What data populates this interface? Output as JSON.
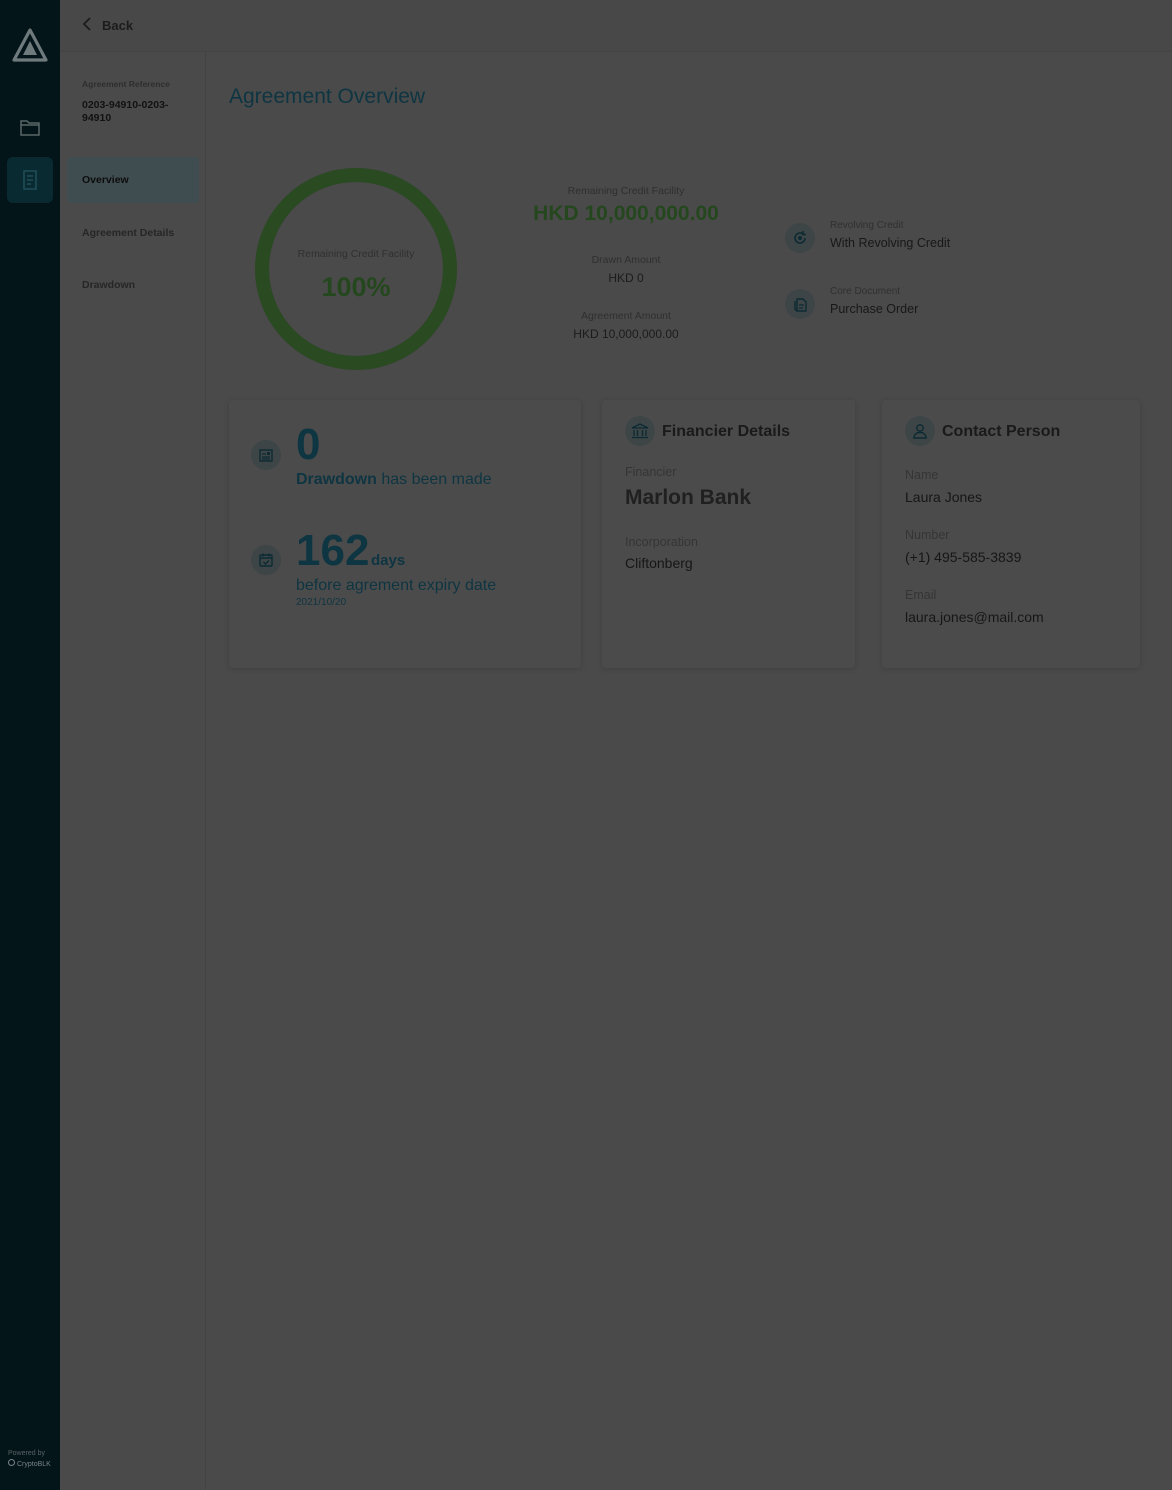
{
  "rail": {
    "icons": [
      "logo-icon",
      "folder-icon",
      "document-icon"
    ],
    "powered_by": "Powered by",
    "brand": "CryptoBLK"
  },
  "topbar": {
    "back_label": "Back"
  },
  "subnav": {
    "reference_label": "Agreement Reference",
    "reference_value": "0203-94910-0203-94910",
    "items": [
      {
        "label": "Overview",
        "active": true
      },
      {
        "label": "Agreement Details",
        "active": false
      },
      {
        "label": "Drawdown",
        "active": false
      }
    ]
  },
  "main": {
    "title": "Agreement Overview",
    "donut": {
      "label": "Remaining Credit Facility",
      "percent_text": "100%",
      "remaining_fraction": 1.0,
      "color": "#2a4a22"
    },
    "summary": {
      "remaining_label": "Remaining Credit Facility",
      "remaining_value": "HKD 10,000,000.00",
      "drawn_label": "Drawn Amount",
      "drawn_value": "HKD 0",
      "agreement_label": "Agreement Amount",
      "agreement_value": "HKD 10,000,000.00"
    },
    "attributes": [
      {
        "icon": "revolving-icon",
        "label": "Revolving Credit",
        "value": "With Revolving Credit"
      },
      {
        "icon": "documents-icon",
        "label": "Core Document",
        "value": "Purchase Order"
      }
    ],
    "stats": {
      "drawdown_count": "0",
      "drawdown_word": "Drawdown",
      "drawdown_rest": "has been made",
      "days_count": "162",
      "days_label": "days",
      "days_text": "before agrement expiry date",
      "expiry_date": "2021/10/20"
    },
    "financier": {
      "title": "Financier Details",
      "financier_label": "Financier",
      "financier_value": "Marlon Bank",
      "incorporation_label": "Incorporation",
      "incorporation_value": "Cliftonberg"
    },
    "contact": {
      "title": "Contact Person",
      "name_label": "Name",
      "name_value": "Laura Jones",
      "number_label": "Number",
      "number_value": "(+1) 495-585-3839",
      "email_label": "Email",
      "email_value": "laura.jones@mail.com"
    }
  }
}
